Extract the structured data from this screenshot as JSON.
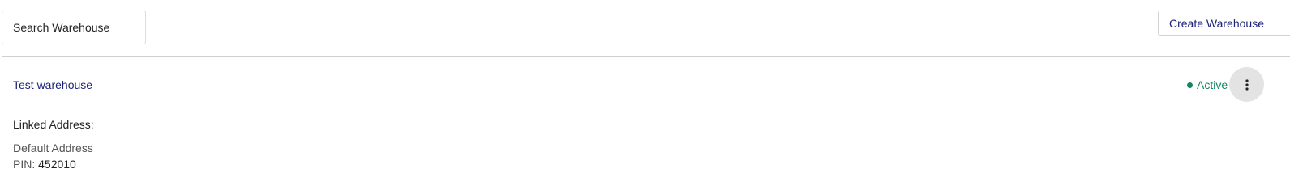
{
  "toolbar": {
    "search_placeholder": "Search Warehouse",
    "create_label": "Create Warehouse"
  },
  "warehouse": {
    "name": "Test warehouse",
    "status": "Active",
    "linked_address_label": "Linked Address:",
    "address_name": "Default Address",
    "pin_label": "PIN:",
    "pin_value": "452010"
  },
  "colors": {
    "link": "#1d237a",
    "status_active": "#11875d",
    "more_button_bg": "#e3e3e3"
  },
  "icons": {
    "more": "vertical-dots-icon",
    "status": "dot-icon"
  }
}
